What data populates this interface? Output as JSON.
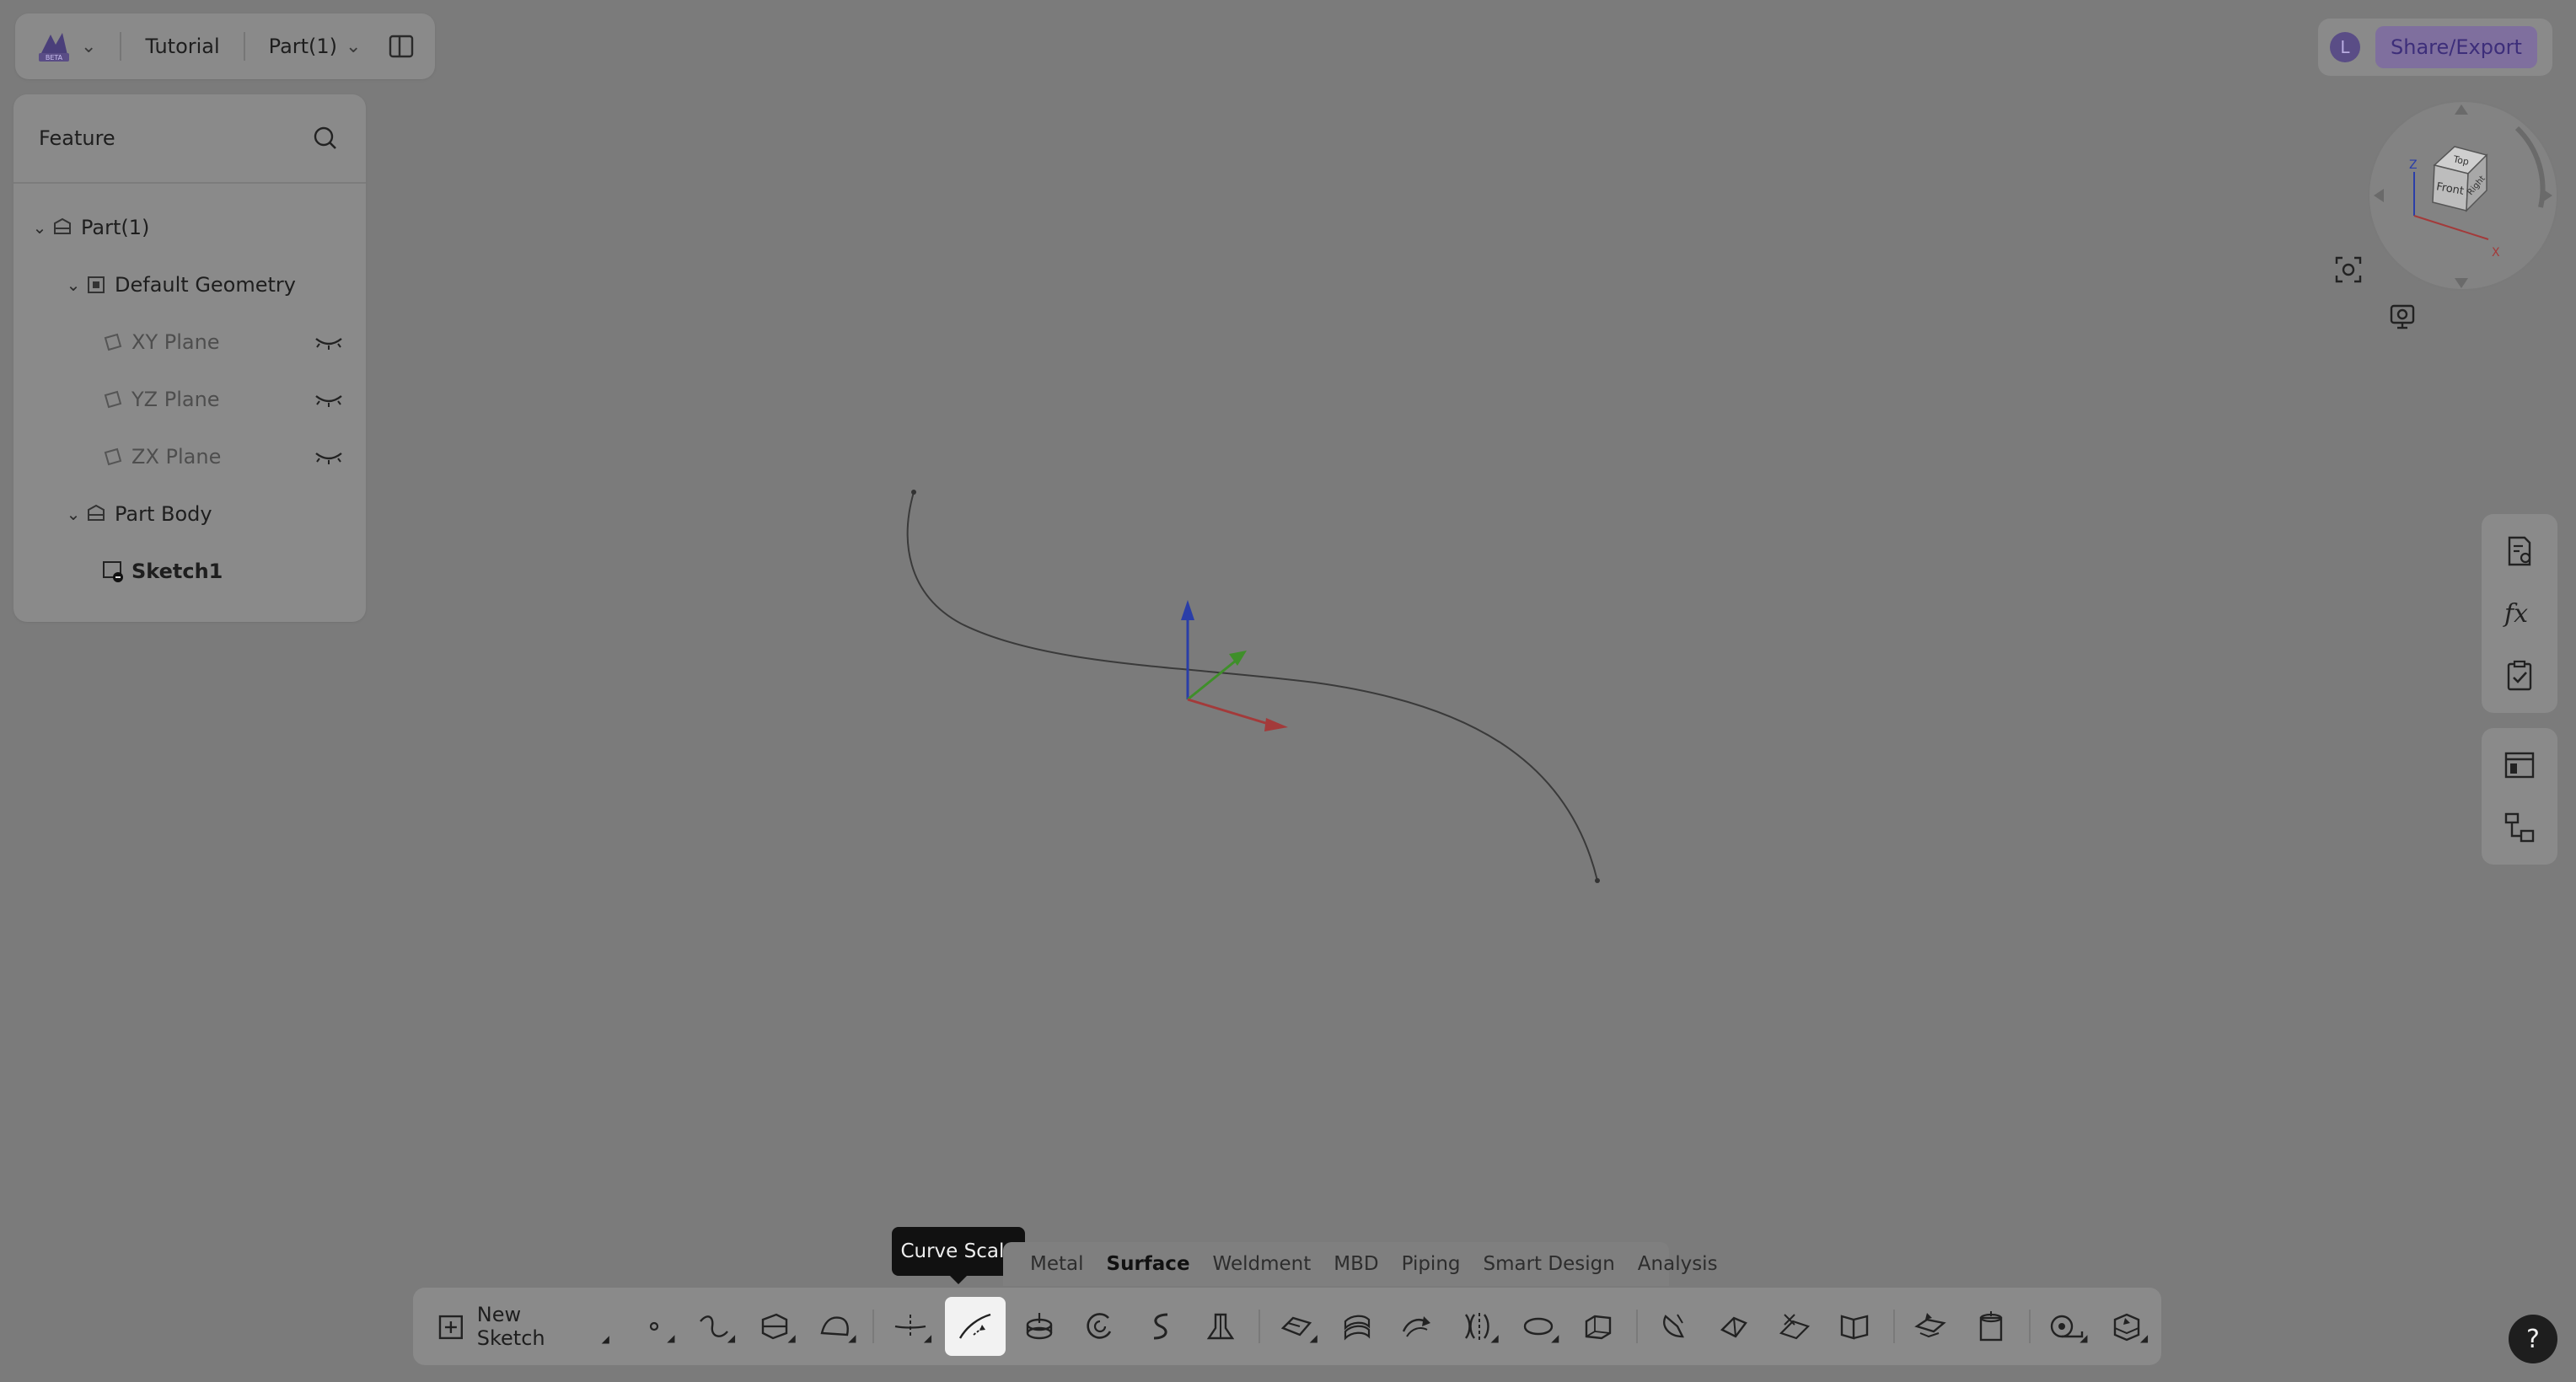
{
  "header": {
    "logo_text": "BETA",
    "project": "Tutorial",
    "part_selector": "Part(1)"
  },
  "feature_panel": {
    "title": "Feature",
    "tree": [
      {
        "label": "Part(1)",
        "level": 0,
        "expanded": true,
        "dim": false
      },
      {
        "label": "Default Geometry",
        "level": 1,
        "expanded": true,
        "dim": false
      },
      {
        "label": "XY Plane",
        "level": 2,
        "dim": true
      },
      {
        "label": "YZ Plane",
        "level": 2,
        "dim": true
      },
      {
        "label": "ZX Plane",
        "level": 2,
        "dim": true
      },
      {
        "label": "Part Body",
        "level": 1,
        "expanded": true,
        "dim": false
      },
      {
        "label": "Sketch1",
        "level": 2,
        "dim": false,
        "bold": true
      }
    ]
  },
  "topbar": {
    "avatar_initial": "L",
    "share_label": "Share/Export"
  },
  "view_cube": {
    "faces": {
      "top": "Top",
      "front": "Front",
      "right": "Right"
    },
    "axes": {
      "z": "Z",
      "x": "X"
    }
  },
  "tooltip": "Curve Scale",
  "tabs": [
    {
      "label": "Metal",
      "active": false
    },
    {
      "label": "Surface",
      "active": true
    },
    {
      "label": "Weldment",
      "active": false
    },
    {
      "label": "MBD",
      "active": false
    },
    {
      "label": "Piping",
      "active": false
    },
    {
      "label": "Smart Design",
      "active": false
    },
    {
      "label": "Analysis",
      "active": false
    }
  ],
  "toolbar": {
    "new_sketch_label": "New Sketch"
  },
  "help_label": "?",
  "colors": {
    "viewport": "#7b7b7b",
    "panel": "#8a8a8a",
    "axis_x": "#a33a3a",
    "axis_y": "#3f8f2a",
    "axis_z": "#2a3ea8",
    "accent": "#5a4d86"
  }
}
